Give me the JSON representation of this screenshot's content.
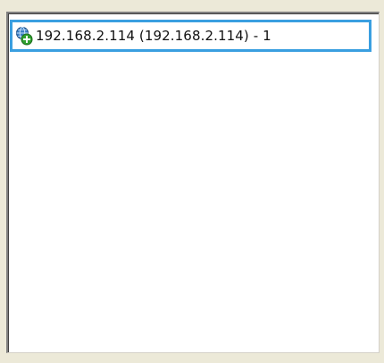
{
  "host_list": {
    "items": [
      {
        "label": "192.168.2.114 (192.168.2.114) - 1",
        "icon": "network-host-add-icon",
        "selected": true
      }
    ]
  },
  "colors": {
    "selection_border": "#3a9fe0",
    "window_background": "#ece9d8",
    "list_background": "#ffffff"
  }
}
